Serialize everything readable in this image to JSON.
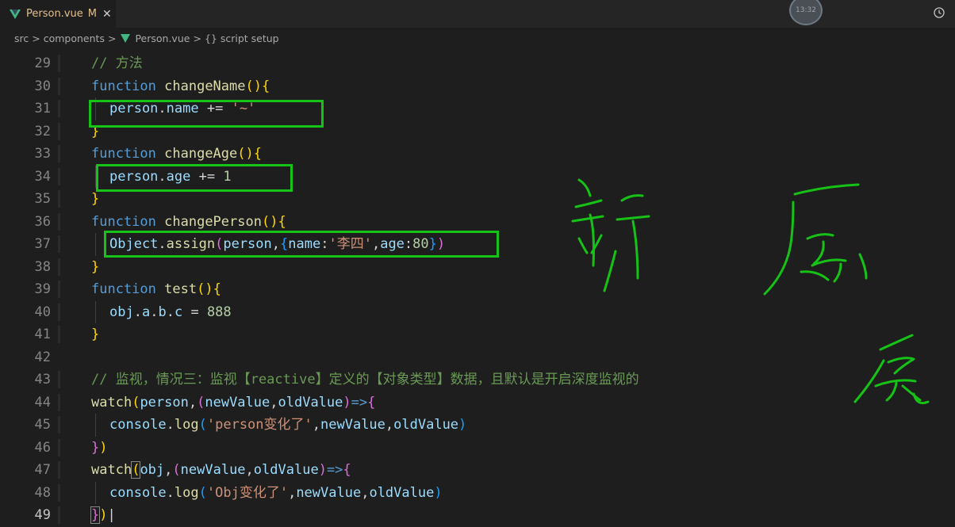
{
  "tab": {
    "filename": "Person.vue",
    "modified": "M",
    "close": "✕"
  },
  "clock": {
    "time": "13:32"
  },
  "breadcrumb": {
    "src": "src",
    "components": "components",
    "file": "Person.vue",
    "scope": "{} script setup",
    "sep": ">"
  },
  "lines": [
    {
      "n": "29"
    },
    {
      "n": "30"
    },
    {
      "n": "31"
    },
    {
      "n": "32"
    },
    {
      "n": "33"
    },
    {
      "n": "34"
    },
    {
      "n": "35"
    },
    {
      "n": "36"
    },
    {
      "n": "37"
    },
    {
      "n": "38"
    },
    {
      "n": "39"
    },
    {
      "n": "40"
    },
    {
      "n": "41"
    },
    {
      "n": "42"
    },
    {
      "n": "43"
    },
    {
      "n": "44"
    },
    {
      "n": "45"
    },
    {
      "n": "46"
    },
    {
      "n": "47"
    },
    {
      "n": "48"
    },
    {
      "n": "49"
    }
  ],
  "code": {
    "l29_comment": "// 方法",
    "l30_kw": "function",
    "l30_fn": "changeName",
    "l31_obj": "person",
    "l31_prop": "name",
    "l31_op": " += ",
    "l31_str": "'~'",
    "l33_kw": "function",
    "l33_fn": "changeAge",
    "l34_obj": "person",
    "l34_prop": "age",
    "l34_op": " += ",
    "l34_num": "1",
    "l36_kw": "function",
    "l36_fn": "changePerson",
    "l37_cls": "Object",
    "l37_fn": "assign",
    "l37_arg": "person",
    "l37_k1": "name",
    "l37_v1": "'李四'",
    "l37_k2": "age",
    "l37_v2": "80",
    "l39_kw": "function",
    "l39_fn": "test",
    "l40_a": "obj",
    "l40_b": "a",
    "l40_c": "b",
    "l40_d": "c",
    "l40_op": " = ",
    "l40_num": "888",
    "l43_comment": "// 监视，情况三：监视【reactive】定义的【对象类型】数据，且默认是开启深度监视的",
    "l44_fn": "watch",
    "l44_arg": "person",
    "l44_p1": "newValue",
    "l44_p2": "oldValue",
    "l44_arrow": "=>",
    "l45_obj": "console",
    "l45_fn": "log",
    "l45_str": "'person变化了'",
    "l45_p1": "newValue",
    "l45_p2": "oldValue",
    "l47_fn": "watch",
    "l47_arg": "obj",
    "l47_p1": "newValue",
    "l47_p2": "oldValue",
    "l47_arrow": "=>",
    "l48_obj": "console",
    "l48_fn": "log",
    "l48_str": "'Obj变化了'",
    "l48_p1": "newValue",
    "l48_p2": "oldValue"
  },
  "colors": {
    "highlight_box": "#16c216",
    "handwriting": "#16c216"
  }
}
